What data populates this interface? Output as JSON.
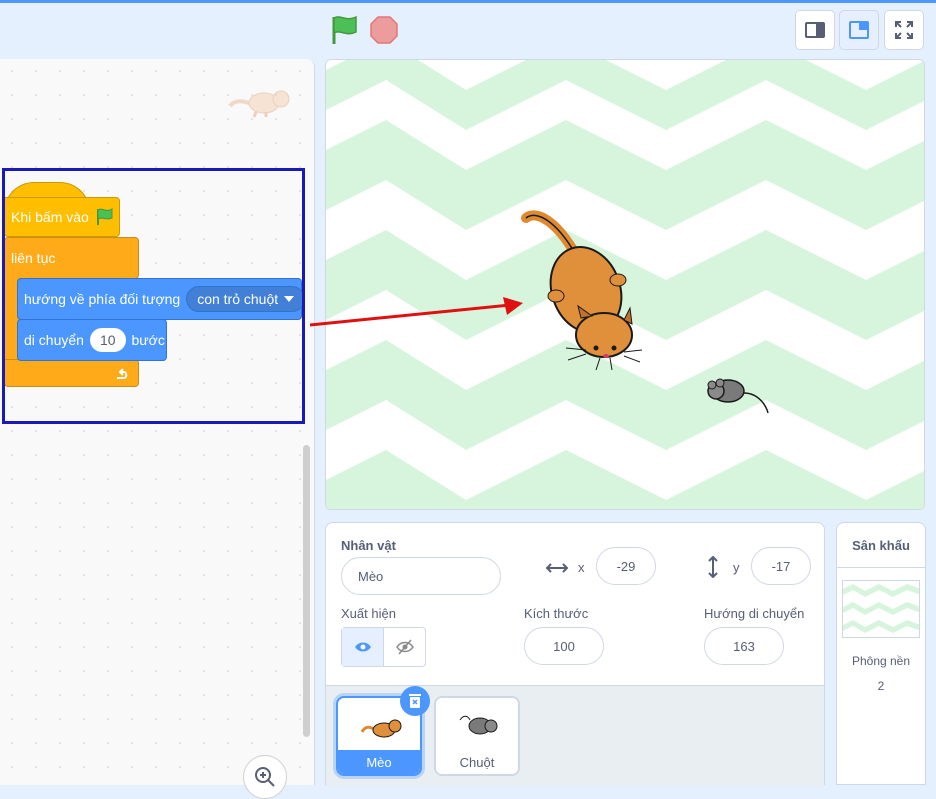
{
  "toolbar": {
    "green_flag_icon": "green-flag-icon",
    "stop_icon": "stop-icon",
    "view_buttons": [
      "small-stage-icon",
      "normal-stage-icon",
      "fullscreen-icon"
    ]
  },
  "code": {
    "event_block": "Khi bấm vào",
    "forever_block": "liên tục",
    "point_towards": {
      "label": "hướng về phía đối tượng",
      "dropdown": "con trỏ chuột"
    },
    "move": {
      "label": "di chuyển",
      "value": "10",
      "suffix": "bước"
    }
  },
  "sprite_info": {
    "sprite_label": "Nhân vật",
    "sprite_name": "Mèo",
    "x_label": "x",
    "x_value": "-29",
    "y_label": "y",
    "y_value": "-17",
    "show_label": "Xuất hiện",
    "size_label": "Kích thước",
    "size_value": "100",
    "direction_label": "Hướng di chuyển",
    "direction_value": "163"
  },
  "sprites": [
    {
      "name": "Mèo",
      "selected": true
    },
    {
      "name": "Chuột",
      "selected": false
    }
  ],
  "stage_panel": {
    "title": "Sân khấu",
    "backdrops_label": "Phông nền",
    "backdrops_count": "2"
  },
  "colors": {
    "accent": "#4c97ff",
    "event": "#ffbf00",
    "control": "#ffab19",
    "motion": "#4c97ff",
    "highlight_box": "#1a1ab8",
    "arrow": "#e01010"
  }
}
